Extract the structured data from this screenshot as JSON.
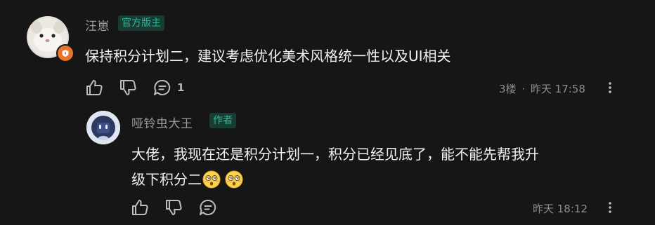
{
  "comment": {
    "username": "汪崽",
    "tag": "官方版主",
    "text": "保持积分计划二，建议考虑优化美术风格统一性以及UI相关",
    "reply_count": "1",
    "floor": "3楼",
    "dot": "·",
    "time": "昨天 17:58"
  },
  "reply": {
    "username": "哑铃虫大王",
    "tag": "作者",
    "text_line1": "大佬，我现在还是积分计划一，积分已经见底了，能不能先帮我升",
    "text_line2": "级下积分二",
    "time": "昨天 18:12"
  },
  "colors": {
    "background": "#161616",
    "tag_bg": "#183b33",
    "tag_text": "#30b894",
    "badge": "#e8732c"
  },
  "icons": [
    "thumbs-up-icon",
    "thumbs-down-icon",
    "reply-bubble-icon",
    "more-vertical-icon",
    "dizzy-face-emoji"
  ]
}
